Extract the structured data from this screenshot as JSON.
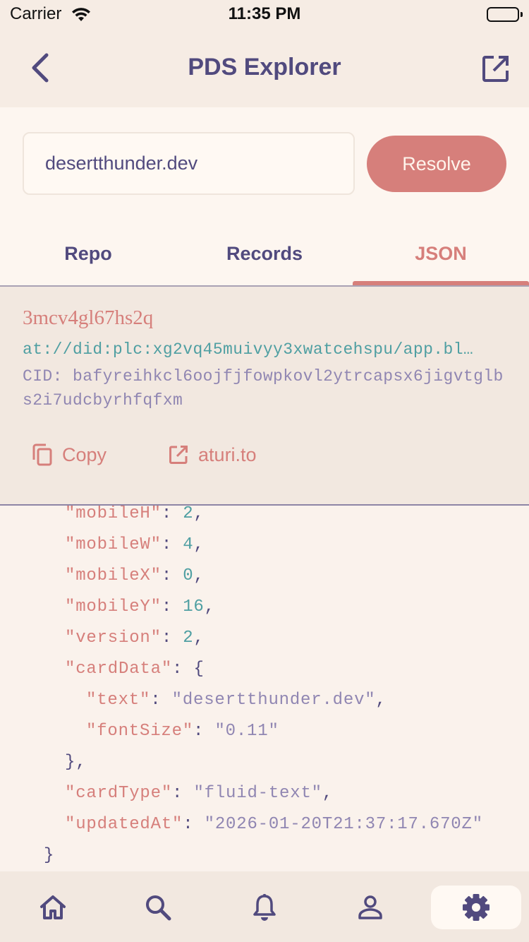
{
  "status_bar": {
    "carrier": "Carrier",
    "time": "11:35 PM"
  },
  "nav": {
    "title": "PDS Explorer"
  },
  "resolve": {
    "input_value": "desertthunder.dev",
    "button_label": "Resolve"
  },
  "tabs": [
    {
      "label": "Repo",
      "active": false
    },
    {
      "label": "Records",
      "active": false
    },
    {
      "label": "JSON",
      "active": true
    }
  ],
  "record": {
    "key": "3mcv4gl67hs2q",
    "uri": "at://did:plc:xg2vq45muivyy3xwatcehspu/app.bl…",
    "cid": "CID: bafyreihkcl6oojfjfowpkovl2ytrcapsx6jigvtglbs2i7udcbyrhfqfxm",
    "actions": {
      "copy_label": "Copy",
      "aturi_label": "aturi.to"
    }
  },
  "json_lines": [
    {
      "indent": 2,
      "key": "\"mobileH\"",
      "value": "2",
      "value_type": "num",
      "trail": ","
    },
    {
      "indent": 2,
      "key": "\"mobileW\"",
      "value": "4",
      "value_type": "num",
      "trail": ","
    },
    {
      "indent": 2,
      "key": "\"mobileX\"",
      "value": "0",
      "value_type": "num",
      "trail": ","
    },
    {
      "indent": 2,
      "key": "\"mobileY\"",
      "value": "16",
      "value_type": "num",
      "trail": ","
    },
    {
      "indent": 2,
      "key": "\"version\"",
      "value": "2",
      "value_type": "num",
      "trail": ","
    },
    {
      "indent": 2,
      "key": "\"cardData\"",
      "value": "{",
      "value_type": "punct",
      "trail": ""
    },
    {
      "indent": 3,
      "key": "\"text\"",
      "value": "\"desertthunder.dev\"",
      "value_type": "str",
      "trail": ","
    },
    {
      "indent": 3,
      "key": "\"fontSize\"",
      "value": "\"0.11\"",
      "value_type": "str",
      "trail": ""
    },
    {
      "indent": 2,
      "key": "",
      "value": "},",
      "value_type": "punct",
      "trail": ""
    },
    {
      "indent": 2,
      "key": "\"cardType\"",
      "value": "\"fluid-text\"",
      "value_type": "str",
      "trail": ","
    },
    {
      "indent": 2,
      "key": "\"updatedAt\"",
      "value": "\"2026-01-20T21:37:17.670Z\"",
      "value_type": "str",
      "trail": ""
    },
    {
      "indent": 1,
      "key": "",
      "value": "}",
      "value_type": "punct",
      "trail": ""
    }
  ],
  "bottom_tabs": [
    {
      "icon": "home-icon",
      "active": false
    },
    {
      "icon": "search-icon",
      "active": false
    },
    {
      "icon": "bell-icon",
      "active": false
    },
    {
      "icon": "profile-icon",
      "active": false
    },
    {
      "icon": "settings-icon",
      "active": true
    }
  ],
  "colors": {
    "background": "#faf2ec",
    "accent": "#d67f7b",
    "primary_text": "#514a7e",
    "teal": "#4f9fa2",
    "muted_purple": "#9086b2"
  }
}
